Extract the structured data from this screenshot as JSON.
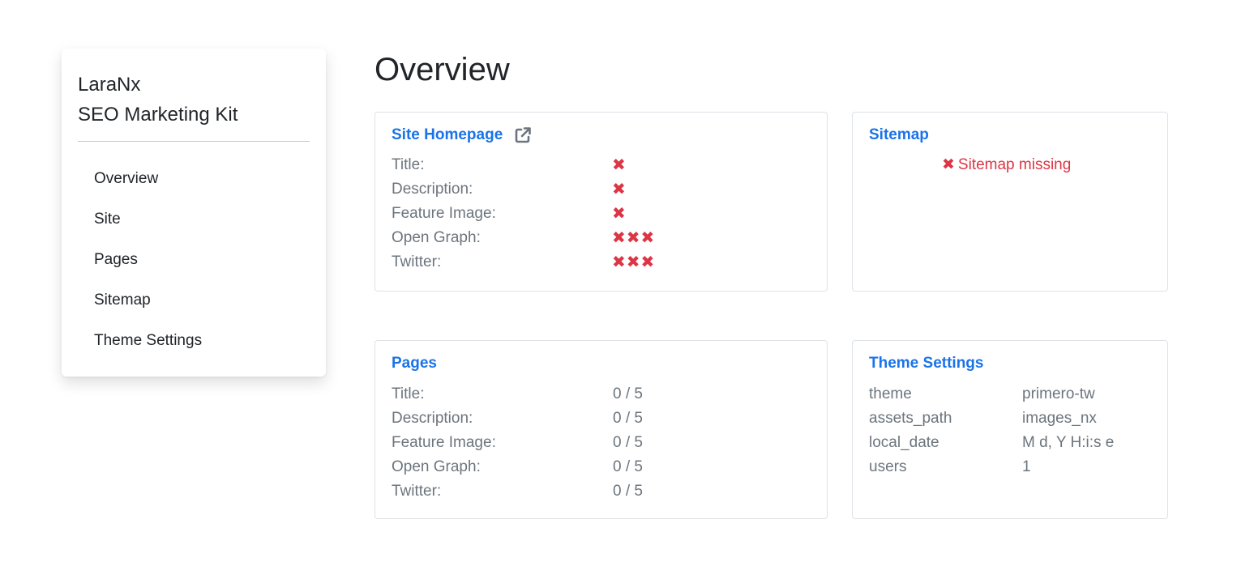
{
  "sidebar": {
    "brand_line1": "LaraNx",
    "brand_line2": "SEO Marketing Kit",
    "items": [
      {
        "label": "Overview"
      },
      {
        "label": "Site"
      },
      {
        "label": "Pages"
      },
      {
        "label": "Sitemap"
      },
      {
        "label": "Theme Settings"
      }
    ]
  },
  "main": {
    "title": "Overview",
    "site_homepage": {
      "title": "Site Homepage",
      "link_icon": "external-link-icon",
      "rows": [
        {
          "label": "Title:",
          "status": "✖"
        },
        {
          "label": "Description:",
          "status": "✖"
        },
        {
          "label": "Feature Image:",
          "status": "✖"
        },
        {
          "label": "Open Graph:",
          "status": "✖✖✖"
        },
        {
          "label": "Twitter:",
          "status": "✖✖✖"
        }
      ]
    },
    "sitemap": {
      "title": "Sitemap",
      "status_icon": "✖",
      "status_text": "Sitemap missing"
    },
    "pages": {
      "title": "Pages",
      "rows": [
        {
          "label": "Title:",
          "value": "0 / 5"
        },
        {
          "label": "Description:",
          "value": "0 / 5"
        },
        {
          "label": "Feature Image:",
          "value": "0 / 5"
        },
        {
          "label": "Open Graph:",
          "value": "0 / 5"
        },
        {
          "label": "Twitter:",
          "value": "0 / 5"
        }
      ]
    },
    "theme_settings": {
      "title": "Theme Settings",
      "rows": [
        {
          "key": "theme",
          "value": "primero-tw"
        },
        {
          "key": "assets_path",
          "value": "images_nx"
        },
        {
          "key": "local_date",
          "value": "M d, Y H:i:s e"
        },
        {
          "key": "users",
          "value": "1"
        }
      ]
    }
  },
  "colors": {
    "link": "#1a73e8",
    "error": "#dc3545",
    "muted": "#6c757d",
    "text": "#212529",
    "border": "#dee2e6"
  }
}
